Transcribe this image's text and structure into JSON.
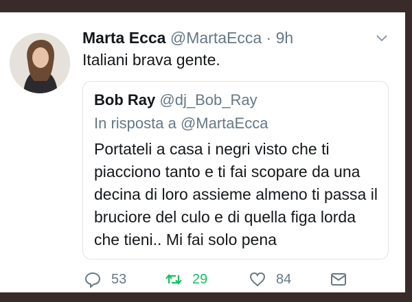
{
  "tweet": {
    "author_name": "Marta Ecca",
    "author_handle": "@MartaEcca",
    "separator": " · ",
    "time": "9h",
    "text": "Italiani brava gente."
  },
  "quoted": {
    "author_name": "Bob Ray",
    "author_handle": "@dj_Bob_Ray",
    "reply_prefix": "In risposta a ",
    "reply_mention": "@MartaEcca",
    "text": "Portateli a casa i negri visto che ti piacciono tanto e ti fai scopare da una decina di loro assieme almeno ti passa il bruciore del culo e di quella figa lorda che tieni.. Mi fai solo pena"
  },
  "actions": {
    "reply_count": "53",
    "retweet_count": "29",
    "like_count": "84"
  },
  "colors": {
    "text": "#14171a",
    "muted": "#657786",
    "retweet_active": "#17bf63",
    "border": "#dde3e8"
  },
  "icons": {
    "reply": "reply-icon",
    "retweet": "retweet-icon",
    "like": "heart-icon",
    "message": "envelope-icon",
    "menu": "chevron-down-icon"
  }
}
